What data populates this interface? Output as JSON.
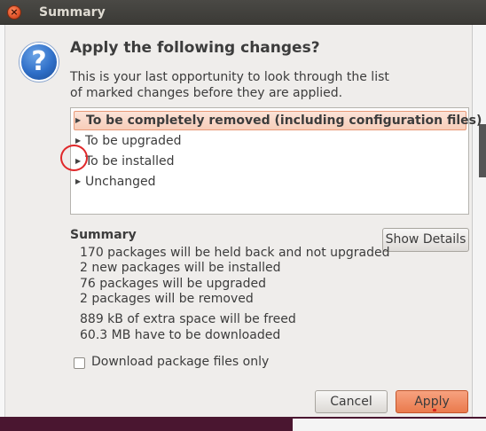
{
  "window": {
    "title": "Summary",
    "close_glyph": "×"
  },
  "dialog": {
    "icon": "question-icon",
    "icon_glyph": "?",
    "heading": "Apply the following changes?",
    "description_line1": "This is your last opportunity to look through the list",
    "description_line2": "of marked changes before they are applied."
  },
  "changes_tree": {
    "rows": [
      {
        "label": "To be completely removed (including configuration files)",
        "selected": true
      },
      {
        "label": "To be upgraded",
        "selected": false
      },
      {
        "label": "To be installed",
        "selected": false
      },
      {
        "label": "Unchanged",
        "selected": false
      }
    ],
    "expander_glyph": "▶"
  },
  "summary": {
    "title": "Summary",
    "show_details_label": "Show Details",
    "lines": [
      "170 packages will be held back and not upgraded",
      "2 new packages will be installed",
      "76 packages will be upgraded",
      "2 packages will be removed"
    ],
    "space_lines": [
      "889 kB of extra space will be freed",
      "60.3 MB have to be downloaded"
    ]
  },
  "download_only": {
    "label": "Download package files only",
    "checked": false
  },
  "buttons": {
    "cancel": "Cancel",
    "apply": "Apply"
  },
  "colors": {
    "accent": "#ea7a4d",
    "selection": "#f7cdb9",
    "annotation": "#e0282a",
    "titlebar": "#3c3b37"
  }
}
